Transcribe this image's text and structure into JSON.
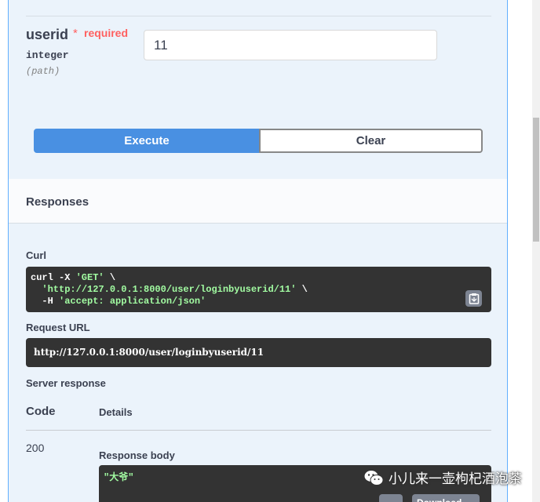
{
  "parameter": {
    "name": "userid",
    "required_star": "*",
    "required_label": "required",
    "type": "integer",
    "location": "(path)",
    "value": "11"
  },
  "actions": {
    "execute_label": "Execute",
    "clear_label": "Clear"
  },
  "responses": {
    "title": "Responses",
    "curl_label": "Curl",
    "curl": {
      "line1_cmd": "curl -X ",
      "line1_method": "'GET'",
      "line1_tail": " \\",
      "line2_indent": "  ",
      "line2_url": "'http://127.0.0.1:8000/user/loginbyuserid/11'",
      "line2_tail": " \\",
      "line3_flag": "  -H ",
      "line3_header": "'accept: application/json'"
    },
    "request_url_label": "Request URL",
    "request_url": "http://127.0.0.1:8000/user/loginbyuserid/11",
    "server_response_label": "Server response",
    "code_header": "Code",
    "details_header": "Details",
    "status_code": "200",
    "response_body_label": "Response body",
    "response_body": "\"大爷\"",
    "download_label": "Download"
  },
  "watermark": {
    "text": "小儿来一壶枸杞酒泡茶"
  },
  "colors": {
    "panel_bg": "#ebf3fb",
    "panel_border": "#61affe",
    "execute_bg": "#4990e2",
    "code_bg": "#333333",
    "string_green": "#a2fca2",
    "required_red": "#ff6060"
  }
}
